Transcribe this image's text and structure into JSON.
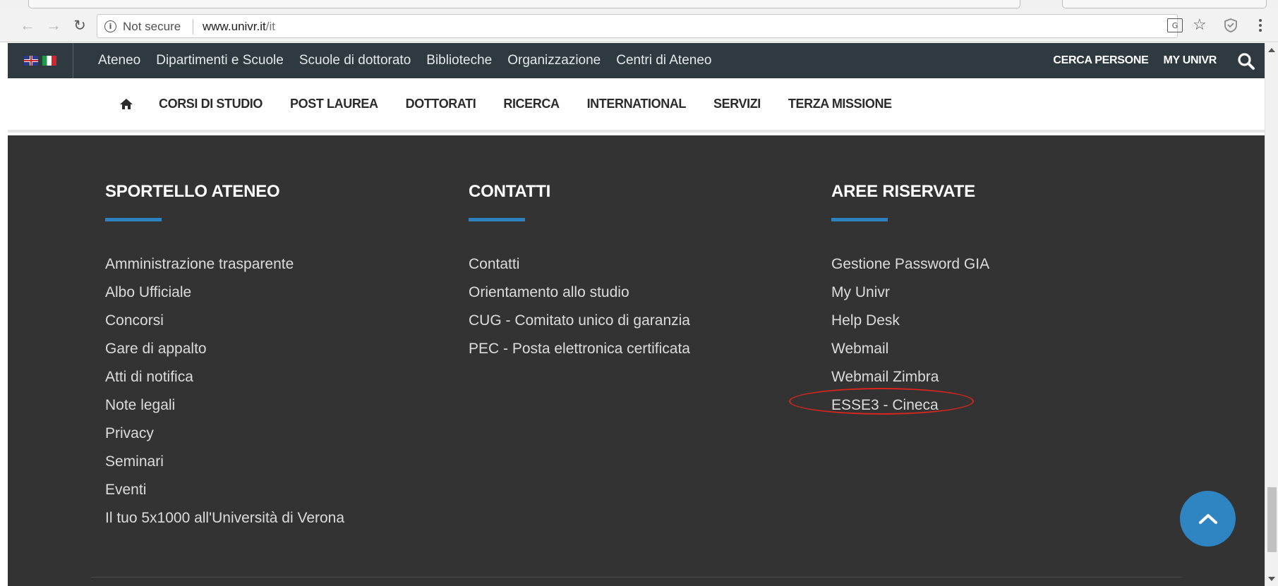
{
  "browser": {
    "security_label": "Not secure",
    "url_host": "www.univr.it",
    "url_path": "/it",
    "icons": [
      "back-icon",
      "forward-icon",
      "reload-icon",
      "info-icon",
      "translate-icon",
      "star-icon",
      "shield-icon",
      "menu-icon"
    ]
  },
  "topbar": {
    "languages": [
      "English",
      "Italiano"
    ],
    "nav": [
      "Ateneo",
      "Dipartimenti e Scuole",
      "Scuole di dottorato",
      "Biblioteche",
      "Organizzazione",
      "Centri di Ateneo"
    ],
    "links": [
      "CERCA PERSONE",
      "MY UNIVR"
    ],
    "bg_color": "#2f3a40"
  },
  "mainnav": {
    "items": [
      "CORSI DI STUDIO",
      "POST LAUREA",
      "DOTTORATI",
      "RICERCA",
      "INTERNATIONAL",
      "SERVIZI",
      "TERZA MISSIONE"
    ]
  },
  "footer": {
    "bg_color": "#333333",
    "accent_color": "#2e82c0",
    "columns": [
      {
        "title": "SPORTELLO ATENEO",
        "links": [
          "Amministrazione trasparente",
          "Albo Ufficiale",
          "Concorsi",
          "Gare di appalto",
          "Atti di notifica",
          "Note legali",
          "Privacy",
          "Seminari",
          "Eventi",
          "Il tuo 5x1000 all'Università di Verona"
        ]
      },
      {
        "title": "CONTATTI",
        "links": [
          "Contatti",
          "Orientamento allo studio",
          "CUG - Comitato unico di garanzia",
          "PEC - Posta elettronica certificata"
        ]
      },
      {
        "title": "AREE RISERVATE",
        "links": [
          "Gestione Password GIA",
          "My Univr",
          "Help Desk",
          "Webmail",
          "Webmail Zimbra",
          "ESSE3 - Cineca"
        ]
      }
    ],
    "highlighted_link": "ESSE3 - Cineca",
    "annotation_color": "#d6261f"
  }
}
